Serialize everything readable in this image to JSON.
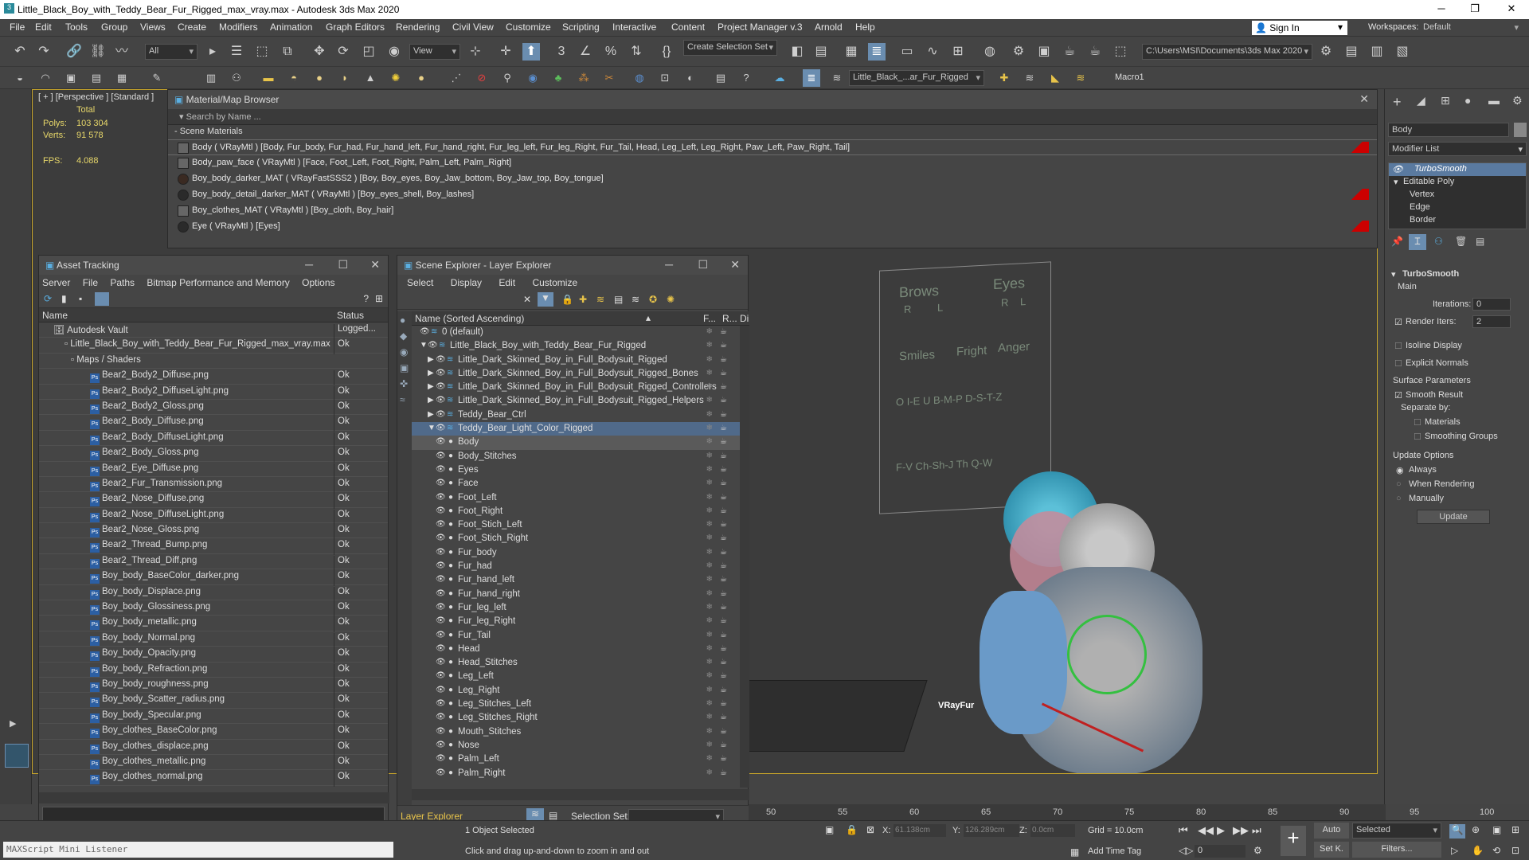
{
  "window": {
    "title": "Little_Black_Boy_with_Teddy_Bear_Fur_Rigged_max_vray.max - Autodesk 3ds Max 2020",
    "controls": [
      "─",
      "❐",
      "✕"
    ]
  },
  "menu": [
    "File",
    "Edit",
    "Tools",
    "Group",
    "Views",
    "Create",
    "Modifiers",
    "Animation",
    "Graph Editors",
    "Rendering",
    "Civil View",
    "Customize",
    "Scripting",
    "Interactive",
    "Content",
    "Project Manager v.3",
    "Arnold",
    "Help"
  ],
  "topright": {
    "sign_in": "Sign In",
    "workspaces_label": "Workspaces:",
    "workspace_value": "Default"
  },
  "toolbar": {
    "filter_all": "All",
    "view": "View",
    "create_selection_set": "Create Selection Set",
    "path": "C:\\Users\\MSI\\Documents\\3ds Max 2020",
    "layer_combo": "Little_Black_...ar_Fur_Rigged",
    "macro": "Macro1"
  },
  "viewport": {
    "label": "[ + ] [Perspective ] [Standard ]",
    "stats_total": "Total",
    "polys_label": "Polys:",
    "polys_value": "103 304",
    "verts_label": "Verts:",
    "verts_value": "91 578",
    "fps_label": "FPS:",
    "fps_value": "4.088",
    "board": {
      "brows": "Brows",
      "eyes": "Eyes",
      "r1": "R",
      "l1": "L",
      "r2": "R",
      "l2": "L",
      "smiles": "Smiles",
      "fright": "Fright",
      "anger": "Anger",
      "row3": "O I-E U B-M-P D-S-T-Z",
      "row4": "F-V Ch-Sh-J Th Q-W"
    },
    "vray_logo": "VRayFur"
  },
  "mat_browser": {
    "title": "Material/Map Browser",
    "search": "Search by Name ...",
    "section": "Scene Materials",
    "rows": [
      {
        "text": "Body  ( VRayMtl ) [Body, Fur_body, Fur_had, Fur_hand_left, Fur_hand_right, Fur_leg_left, Fur_leg_Right, Fur_Tail, Head, Leg_Left, Leg_Right, Paw_Left, Paw_Right, Tail]",
        "red": true
      },
      {
        "text": "Body_paw_face  ( VRayMtl ) [Face, Foot_Left, Foot_Right, Palm_Left, Palm_Right]",
        "red": false
      },
      {
        "text": "Boy_body_darker_MAT  ( VRayFastSSS2 ) [Boy, Boy_eyes, Boy_Jaw_bottom, Boy_Jaw_top, Boy_tongue]",
        "red": false
      },
      {
        "text": "Boy_body_detail_darker_MAT  ( VRayMtl ) [Boy_eyes_shell, Boy_lashes]",
        "red": true
      },
      {
        "text": "Boy_clothes_MAT  ( VRayMtl ) [Boy_cloth, Boy_hair]",
        "red": false
      },
      {
        "text": "Eye  ( VRayMtl ) [Eyes]",
        "red": true
      }
    ]
  },
  "asset_tracking": {
    "title": "Asset Tracking",
    "menu": [
      "Server",
      "File",
      "Paths",
      "Bitmap Performance and Memory",
      "Options"
    ],
    "col_name": "Name",
    "col_status": "Status",
    "vault": {
      "name": "Autodesk Vault",
      "status": "Logged..."
    },
    "file": {
      "name": "Little_Black_Boy_with_Teddy_Bear_Fur_Rigged_max_vray.max",
      "status": "Ok"
    },
    "folder": "Maps / Shaders",
    "ps_glyph": "Ps",
    "maps": [
      {
        "name": "Bear2_Body2_Diffuse.png",
        "status": "Ok"
      },
      {
        "name": "Bear2_Body2_DiffuseLight.png",
        "status": "Ok"
      },
      {
        "name": "Bear2_Body2_Gloss.png",
        "status": "Ok"
      },
      {
        "name": "Bear2_Body_Diffuse.png",
        "status": "Ok"
      },
      {
        "name": "Bear2_Body_DiffuseLight.png",
        "status": "Ok"
      },
      {
        "name": "Bear2_Body_Gloss.png",
        "status": "Ok"
      },
      {
        "name": "Bear2_Eye_Diffuse.png",
        "status": "Ok"
      },
      {
        "name": "Bear2_Fur_Transmission.png",
        "status": "Ok"
      },
      {
        "name": "Bear2_Nose_Diffuse.png",
        "status": "Ok"
      },
      {
        "name": "Bear2_Nose_DiffuseLight.png",
        "status": "Ok"
      },
      {
        "name": "Bear2_Nose_Gloss.png",
        "status": "Ok"
      },
      {
        "name": "Bear2_Thread_Bump.png",
        "status": "Ok"
      },
      {
        "name": "Bear2_Thread_Diff.png",
        "status": "Ok"
      },
      {
        "name": "Boy_body_BaseColor_darker.png",
        "status": "Ok"
      },
      {
        "name": "Boy_body_Displace.png",
        "status": "Ok"
      },
      {
        "name": "Boy_body_Glossiness.png",
        "status": "Ok"
      },
      {
        "name": "Boy_body_metallic.png",
        "status": "Ok"
      },
      {
        "name": "Boy_body_Normal.png",
        "status": "Ok"
      },
      {
        "name": "Boy_body_Opacity.png",
        "status": "Ok"
      },
      {
        "name": "Boy_body_Refraction.png",
        "status": "Ok"
      },
      {
        "name": "Boy_body_roughness.png",
        "status": "Ok"
      },
      {
        "name": "Boy_body_Scatter_radius.png",
        "status": "Ok"
      },
      {
        "name": "Boy_body_Specular.png",
        "status": "Ok"
      },
      {
        "name": "Boy_clothes_BaseColor.png",
        "status": "Ok"
      },
      {
        "name": "Boy_clothes_displace.png",
        "status": "Ok"
      },
      {
        "name": "Boy_clothes_metallic.png",
        "status": "Ok"
      },
      {
        "name": "Boy_clothes_normal.png",
        "status": "Ok"
      }
    ]
  },
  "scene_explorer": {
    "title": "Scene Explorer - Layer Explorer",
    "menu": [
      "Select",
      "Display",
      "Edit",
      "Customize"
    ],
    "col_name": "Name (Sorted Ascending)",
    "col_f": "F...",
    "col_r": "R...",
    "col_d": "Di",
    "layers": [
      {
        "name": "0 (default)",
        "indent": 0,
        "arrow": ""
      },
      {
        "name": "Little_Black_Boy_with_Teddy_Bear_Fur_Rigged",
        "indent": 1,
        "arrow": "▼"
      },
      {
        "name": "Little_Dark_Skinned_Boy_in_Full_Bodysuit_Rigged",
        "indent": 2,
        "arrow": "▶"
      },
      {
        "name": "Little_Dark_Skinned_Boy_in_Full_Bodysuit_Rigged_Bones",
        "indent": 2,
        "arrow": "▶"
      },
      {
        "name": "Little_Dark_Skinned_Boy_in_Full_Bodysuit_Rigged_Controllers",
        "indent": 2,
        "arrow": "▶"
      },
      {
        "name": "Little_Dark_Skinned_Boy_in_Full_Bodysuit_Rigged_Helpers",
        "indent": 2,
        "arrow": "▶"
      },
      {
        "name": "Teddy_Bear_Ctrl",
        "indent": 2,
        "arrow": "▶"
      },
      {
        "name": "Teddy_Bear_Light_Color_Rigged",
        "indent": 2,
        "arrow": "▼"
      }
    ],
    "objects": [
      "Body",
      "Body_Stitches",
      "Eyes",
      "Face",
      "Foot_Left",
      "Foot_Right",
      "Foot_Stich_Left",
      "Foot_Stich_Right",
      "Fur_body",
      "Fur_had",
      "Fur_hand_left",
      "Fur_hand_right",
      "Fur_leg_left",
      "Fur_leg_Right",
      "Fur_Tail",
      "Head",
      "Head_Stitches",
      "Leg_Left",
      "Leg_Right",
      "Leg_Stitches_Left",
      "Leg_Stitches_Right",
      "Mouth_Stitches",
      "Nose",
      "Palm_Left",
      "Palm_Right"
    ],
    "footer_label": "Layer Explorer",
    "selection_set_label": "Selection Set:"
  },
  "command_panel": {
    "object_name": "Body",
    "modifier_list": "Modifier List",
    "stack": [
      "TurboSmooth",
      "Editable Poly",
      "Vertex",
      "Edge",
      "Border"
    ],
    "rollout_title": "TurboSmooth",
    "main": "Main",
    "iterations_label": "Iterations:",
    "iterations_value": "0",
    "render_iters_label": "Render Iters:",
    "render_iters_value": "2",
    "isoline": "Isoline Display",
    "explicit": "Explicit Normals",
    "surface_params": "Surface Parameters",
    "smooth_result": "Smooth Result",
    "separate_by": "Separate by:",
    "materials": "Materials",
    "smoothing_groups": "Smoothing Groups",
    "update_options": "Update Options",
    "always": "Always",
    "when_rendering": "When Rendering",
    "manually": "Manually",
    "update_btn": "Update"
  },
  "timeline": {
    "ticks": [
      "50",
      "55",
      "60",
      "65",
      "70",
      "75",
      "80",
      "85",
      "90",
      "95",
      "100"
    ]
  },
  "status": {
    "maxscript": "MAXScript Mini Listener",
    "selected": "1 Object Selected",
    "hint": "Click and drag up-and-down to zoom in and out",
    "x_label": "X:",
    "x_value": "61.138cm",
    "y_label": "Y:",
    "y_value": "126.289cm",
    "z_label": "Z:",
    "z_value": "0.0cm",
    "grid": "Grid = 10.0cm",
    "add_time_tag": "Add Time Tag",
    "auto": "Auto",
    "set_k": "Set K.",
    "selected_combo": "Selected",
    "filters": "Filters...",
    "frame": "0"
  }
}
